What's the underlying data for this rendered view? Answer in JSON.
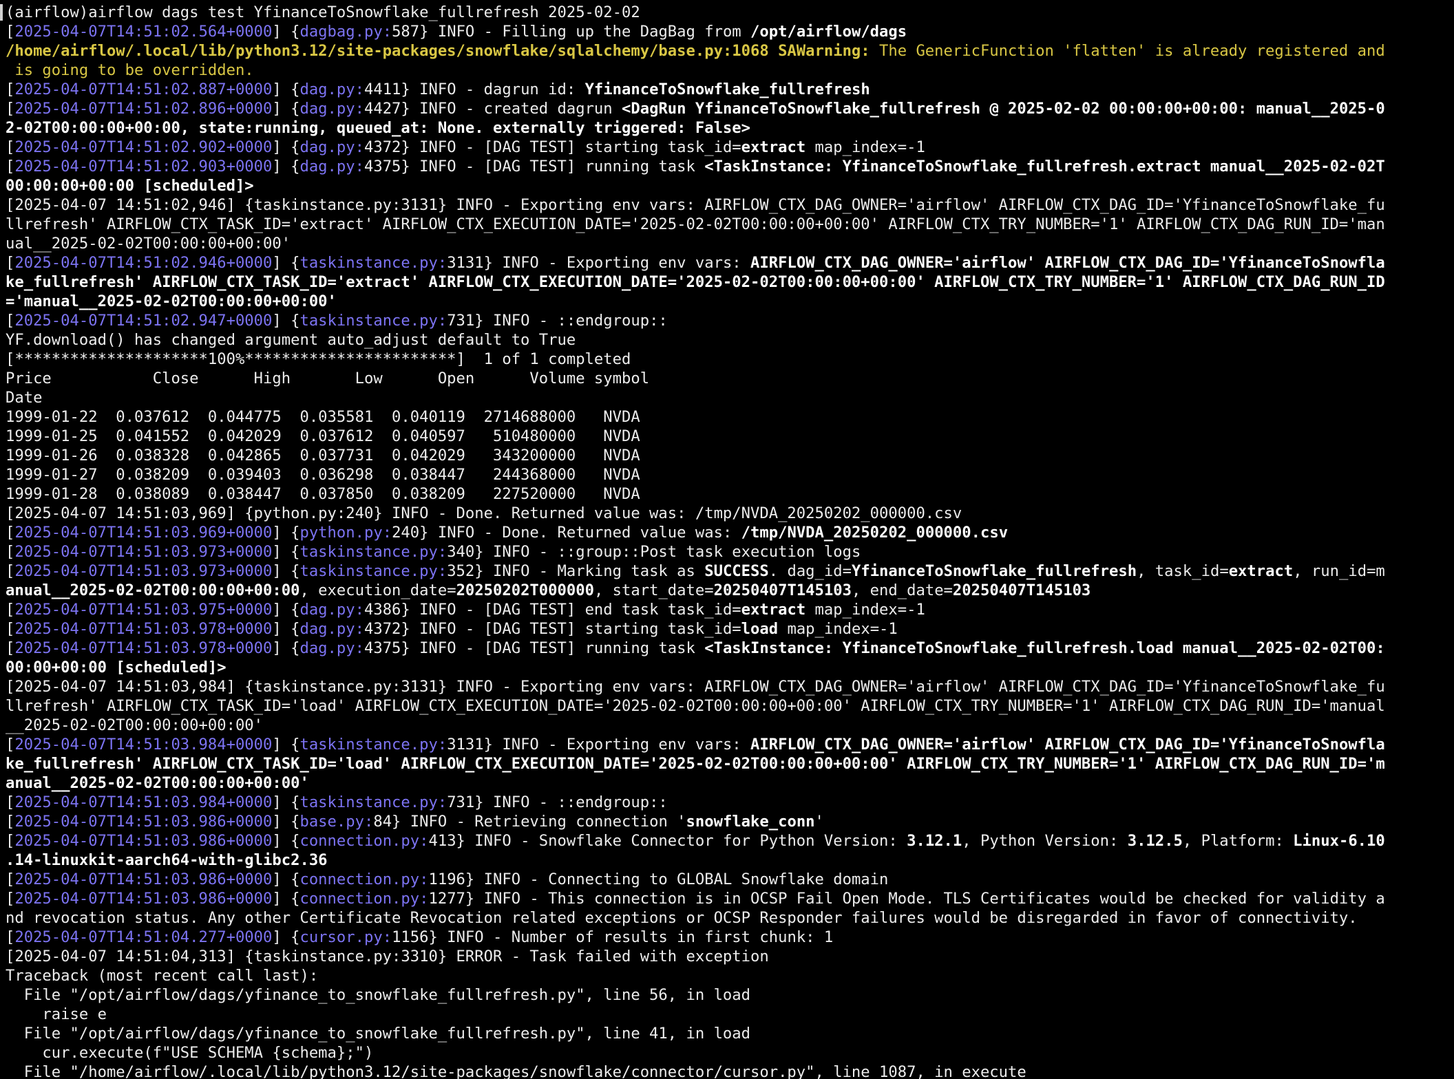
{
  "window": {
    "type": "terminal"
  },
  "lines": [
    [
      {
        "t": "(airflow)airflow dags test YfinanceToSnowflake_fullrefresh 2025-02-02"
      }
    ],
    [
      {
        "t": "["
      },
      {
        "t": "2025-04-07T14:51:02.564+0000",
        "s": "ts"
      },
      {
        "t": "] {"
      },
      {
        "t": "dagbag.py:",
        "s": "src"
      },
      {
        "t": "587} INFO - Filling up the DagBag from "
      },
      {
        "t": "/opt/airflow/dags",
        "s": "b"
      }
    ],
    [
      {
        "t": "/home/airflow/.local/lib/python3.12/site-packages/snowflake/sqlalchemy/base.py:1068 SAWarning:",
        "s": "warnb"
      },
      {
        "t": " The GenericFunction 'flatten' is already registered and",
        "s": "warn"
      }
    ],
    [
      {
        "t": " is going to be overridden.",
        "s": "warn"
      }
    ],
    [
      {
        "t": "["
      },
      {
        "t": "2025-04-07T14:51:02.887+0000",
        "s": "ts"
      },
      {
        "t": "] {"
      },
      {
        "t": "dag.py:",
        "s": "src"
      },
      {
        "t": "4411} INFO - dagrun id: "
      },
      {
        "t": "YfinanceToSnowflake_fullrefresh",
        "s": "b"
      }
    ],
    [
      {
        "t": "["
      },
      {
        "t": "2025-04-07T14:51:02.896+0000",
        "s": "ts"
      },
      {
        "t": "] {"
      },
      {
        "t": "dag.py:",
        "s": "src"
      },
      {
        "t": "4427} INFO - created dagrun "
      },
      {
        "t": "<DagRun YfinanceToSnowflake_fullrefresh @ 2025-02-02 00:00:00+00:00: manual__2025-0",
        "s": "b"
      }
    ],
    [
      {
        "t": "2-02T00:00:00+00:00, state:running, queued_at: None. externally triggered: False>",
        "s": "b"
      }
    ],
    [
      {
        "t": "["
      },
      {
        "t": "2025-04-07T14:51:02.902+0000",
        "s": "ts"
      },
      {
        "t": "] {"
      },
      {
        "t": "dag.py:",
        "s": "src"
      },
      {
        "t": "4372} INFO - [DAG TEST] starting task_id="
      },
      {
        "t": "extract",
        "s": "b"
      },
      {
        "t": " map_index=-1"
      }
    ],
    [
      {
        "t": "["
      },
      {
        "t": "2025-04-07T14:51:02.903+0000",
        "s": "ts"
      },
      {
        "t": "] {"
      },
      {
        "t": "dag.py:",
        "s": "src"
      },
      {
        "t": "4375} INFO - [DAG TEST] running task "
      },
      {
        "t": "<TaskInstance: YfinanceToSnowflake_fullrefresh.extract manual__2025-02-02T",
        "s": "b"
      }
    ],
    [
      {
        "t": "00:00:00+00:00 [scheduled]>",
        "s": "b"
      }
    ],
    [
      {
        "t": "[2025-04-07 14:51:02,946] {taskinstance.py:3131} INFO - Exporting env vars: AIRFLOW_CTX_DAG_OWNER='airflow' AIRFLOW_CTX_DAG_ID='YfinanceToSnowflake_fu"
      }
    ],
    [
      {
        "t": "llrefresh' AIRFLOW_CTX_TASK_ID='extract' AIRFLOW_CTX_EXECUTION_DATE='2025-02-02T00:00:00+00:00' AIRFLOW_CTX_TRY_NUMBER='1' AIRFLOW_CTX_DAG_RUN_ID='man"
      }
    ],
    [
      {
        "t": "ual__2025-02-02T00:00:00+00:00'"
      }
    ],
    [
      {
        "t": "["
      },
      {
        "t": "2025-04-07T14:51:02.946+0000",
        "s": "ts"
      },
      {
        "t": "] {"
      },
      {
        "t": "taskinstance.py:",
        "s": "src"
      },
      {
        "t": "3131} INFO - Exporting env vars: "
      },
      {
        "t": "AIRFLOW_CTX_DAG_OWNER='airflow' AIRFLOW_CTX_DAG_ID='YfinanceToSnowfla",
        "s": "b"
      }
    ],
    [
      {
        "t": "ke_fullrefresh' AIRFLOW_CTX_TASK_ID='extract' AIRFLOW_CTX_EXECUTION_DATE='2025-02-02T00:00:00+00:00' AIRFLOW_CTX_TRY_NUMBER='1' AIRFLOW_CTX_DAG_RUN_ID",
        "s": "b"
      }
    ],
    [
      {
        "t": "='manual__2025-02-02T00:00:00+00:00'",
        "s": "b"
      }
    ],
    [
      {
        "t": "["
      },
      {
        "t": "2025-04-07T14:51:02.947+0000",
        "s": "ts"
      },
      {
        "t": "] {"
      },
      {
        "t": "taskinstance.py:",
        "s": "src"
      },
      {
        "t": "731} INFO - ::endgroup::"
      }
    ],
    [
      {
        "t": "YF.download() has changed argument auto_adjust default to True"
      }
    ],
    [
      {
        "t": "[*********************100%***********************]  1 of 1 completed"
      }
    ],
    [
      {
        "t": "Price           Close      High       Low      Open      Volume symbol"
      }
    ],
    [
      {
        "t": "Date"
      }
    ],
    [
      {
        "t": "1999-01-22  0.037612  0.044775  0.035581  0.040119  2714688000   NVDA"
      }
    ],
    [
      {
        "t": "1999-01-25  0.041552  0.042029  0.037612  0.040597   510480000   NVDA"
      }
    ],
    [
      {
        "t": "1999-01-26  0.038328  0.042865  0.037731  0.042029   343200000   NVDA"
      }
    ],
    [
      {
        "t": "1999-01-27  0.038209  0.039403  0.036298  0.038447   244368000   NVDA"
      }
    ],
    [
      {
        "t": "1999-01-28  0.038089  0.038447  0.037850  0.038209   227520000   NVDA"
      }
    ],
    [
      {
        "t": "[2025-04-07 14:51:03,969] {python.py:240} INFO - Done. Returned value was: /tmp/NVDA_20250202_000000.csv"
      }
    ],
    [
      {
        "t": "["
      },
      {
        "t": "2025-04-07T14:51:03.969+0000",
        "s": "ts"
      },
      {
        "t": "] {"
      },
      {
        "t": "python.py:",
        "s": "src"
      },
      {
        "t": "240} INFO - Done. Returned value was: "
      },
      {
        "t": "/tmp/NVDA_20250202_000000.csv",
        "s": "b"
      }
    ],
    [
      {
        "t": "["
      },
      {
        "t": "2025-04-07T14:51:03.973+0000",
        "s": "ts"
      },
      {
        "t": "] {"
      },
      {
        "t": "taskinstance.py:",
        "s": "src"
      },
      {
        "t": "340} INFO - ::group::Post task execution logs"
      }
    ],
    [
      {
        "t": "["
      },
      {
        "t": "2025-04-07T14:51:03.973+0000",
        "s": "ts"
      },
      {
        "t": "] {"
      },
      {
        "t": "taskinstance.py:",
        "s": "src"
      },
      {
        "t": "352} INFO - Marking task as "
      },
      {
        "t": "SUCCESS",
        "s": "b"
      },
      {
        "t": ". dag_id="
      },
      {
        "t": "YfinanceToSnowflake_fullrefresh",
        "s": "b"
      },
      {
        "t": ", task_id="
      },
      {
        "t": "extract",
        "s": "b"
      },
      {
        "t": ", run_id=m"
      }
    ],
    [
      {
        "t": "anual__2025-02-02T00:00:00+00:00",
        "s": "b"
      },
      {
        "t": ", execution_date="
      },
      {
        "t": "20250202T000000",
        "s": "b"
      },
      {
        "t": ", start_date="
      },
      {
        "t": "20250407T145103",
        "s": "b"
      },
      {
        "t": ", end_date="
      },
      {
        "t": "20250407T145103",
        "s": "b"
      }
    ],
    [
      {
        "t": "["
      },
      {
        "t": "2025-04-07T14:51:03.975+0000",
        "s": "ts"
      },
      {
        "t": "] {"
      },
      {
        "t": "dag.py:",
        "s": "src"
      },
      {
        "t": "4386} INFO - [DAG TEST] end task task_id="
      },
      {
        "t": "extract",
        "s": "b"
      },
      {
        "t": " map_index=-1"
      }
    ],
    [
      {
        "t": "["
      },
      {
        "t": "2025-04-07T14:51:03.978+0000",
        "s": "ts"
      },
      {
        "t": "] {"
      },
      {
        "t": "dag.py:",
        "s": "src"
      },
      {
        "t": "4372} INFO - [DAG TEST] starting task_id="
      },
      {
        "t": "load",
        "s": "b"
      },
      {
        "t": " map_index=-1"
      }
    ],
    [
      {
        "t": "["
      },
      {
        "t": "2025-04-07T14:51:03.978+0000",
        "s": "ts"
      },
      {
        "t": "] {"
      },
      {
        "t": "dag.py:",
        "s": "src"
      },
      {
        "t": "4375} INFO - [DAG TEST] running task "
      },
      {
        "t": "<TaskInstance: YfinanceToSnowflake_fullrefresh.load manual__2025-02-02T00:",
        "s": "b"
      }
    ],
    [
      {
        "t": "00:00+00:00 [scheduled]>",
        "s": "b"
      }
    ],
    [
      {
        "t": "[2025-04-07 14:51:03,984] {taskinstance.py:3131} INFO - Exporting env vars: AIRFLOW_CTX_DAG_OWNER='airflow' AIRFLOW_CTX_DAG_ID='YfinanceToSnowflake_fu"
      }
    ],
    [
      {
        "t": "llrefresh' AIRFLOW_CTX_TASK_ID='load' AIRFLOW_CTX_EXECUTION_DATE='2025-02-02T00:00:00+00:00' AIRFLOW_CTX_TRY_NUMBER='1' AIRFLOW_CTX_DAG_RUN_ID='manual"
      }
    ],
    [
      {
        "t": "__2025-02-02T00:00:00+00:00'"
      }
    ],
    [
      {
        "t": "["
      },
      {
        "t": "2025-04-07T14:51:03.984+0000",
        "s": "ts"
      },
      {
        "t": "] {"
      },
      {
        "t": "taskinstance.py:",
        "s": "src"
      },
      {
        "t": "3131} INFO - Exporting env vars: "
      },
      {
        "t": "AIRFLOW_CTX_DAG_OWNER='airflow' AIRFLOW_CTX_DAG_ID='YfinanceToSnowfla",
        "s": "b"
      }
    ],
    [
      {
        "t": "ke_fullrefresh' AIRFLOW_CTX_TASK_ID='load' AIRFLOW_CTX_EXECUTION_DATE='2025-02-02T00:00:00+00:00' AIRFLOW_CTX_TRY_NUMBER='1' AIRFLOW_CTX_DAG_RUN_ID='m",
        "s": "b"
      }
    ],
    [
      {
        "t": "anual__2025-02-02T00:00:00+00:00'",
        "s": "b"
      }
    ],
    [
      {
        "t": "["
      },
      {
        "t": "2025-04-07T14:51:03.984+0000",
        "s": "ts"
      },
      {
        "t": "] {"
      },
      {
        "t": "taskinstance.py:",
        "s": "src"
      },
      {
        "t": "731} INFO - ::endgroup::"
      }
    ],
    [
      {
        "t": "["
      },
      {
        "t": "2025-04-07T14:51:03.986+0000",
        "s": "ts"
      },
      {
        "t": "] {"
      },
      {
        "t": "base.py:",
        "s": "src"
      },
      {
        "t": "84} INFO - Retrieving connection '"
      },
      {
        "t": "snowflake_conn",
        "s": "b"
      },
      {
        "t": "'"
      }
    ],
    [
      {
        "t": "["
      },
      {
        "t": "2025-04-07T14:51:03.986+0000",
        "s": "ts"
      },
      {
        "t": "] {"
      },
      {
        "t": "connection.py:",
        "s": "src"
      },
      {
        "t": "413} INFO - Snowflake Connector for Python Version: "
      },
      {
        "t": "3.12.1",
        "s": "b"
      },
      {
        "t": ", Python Version: "
      },
      {
        "t": "3.12.5",
        "s": "b"
      },
      {
        "t": ", Platform: "
      },
      {
        "t": "Linux-6.10",
        "s": "b"
      }
    ],
    [
      {
        "t": ".14-linuxkit-aarch64-with-glibc2.36",
        "s": "b"
      }
    ],
    [
      {
        "t": "["
      },
      {
        "t": "2025-04-07T14:51:03.986+0000",
        "s": "ts"
      },
      {
        "t": "] {"
      },
      {
        "t": "connection.py:",
        "s": "src"
      },
      {
        "t": "1196} INFO - Connecting to GLOBAL Snowflake domain"
      }
    ],
    [
      {
        "t": "["
      },
      {
        "t": "2025-04-07T14:51:03.986+0000",
        "s": "ts"
      },
      {
        "t": "] {"
      },
      {
        "t": "connection.py:",
        "s": "src"
      },
      {
        "t": "1277} INFO - This connection is in OCSP Fail Open Mode. TLS Certificates would be checked for validity a"
      }
    ],
    [
      {
        "t": "nd revocation status. Any other Certificate Revocation related exceptions or OCSP Responder failures would be disregarded in favor of connectivity."
      }
    ],
    [
      {
        "t": "["
      },
      {
        "t": "2025-04-07T14:51:04.277+0000",
        "s": "ts"
      },
      {
        "t": "] {"
      },
      {
        "t": "cursor.py:",
        "s": "src"
      },
      {
        "t": "1156} INFO - Number of results in first chunk: 1"
      }
    ],
    [
      {
        "t": "[2025-04-07 14:51:04,313] {taskinstance.py:3310} ERROR - Task failed with exception"
      }
    ],
    [
      {
        "t": "Traceback (most recent call last):"
      }
    ],
    [
      {
        "t": "  File \"/opt/airflow/dags/yfinance_to_snowflake_fullrefresh.py\", line 56, in load"
      }
    ],
    [
      {
        "t": "    raise e"
      }
    ],
    [
      {
        "t": "  File \"/opt/airflow/dags/yfinance_to_snowflake_fullrefresh.py\", line 41, in load"
      }
    ],
    [
      {
        "t": "    cur.execute(f\"USE SCHEMA {schema};\")"
      }
    ],
    [
      {
        "t": "  File \"/home/airflow/.local/lib/python3.12/site-packages/snowflake/connector/cursor.py\", line 1087, in execute"
      }
    ]
  ],
  "colors": {
    "background": "#000000",
    "text": "#ececec",
    "timestamp": "#7c73f2",
    "warning": "#d8c644"
  }
}
